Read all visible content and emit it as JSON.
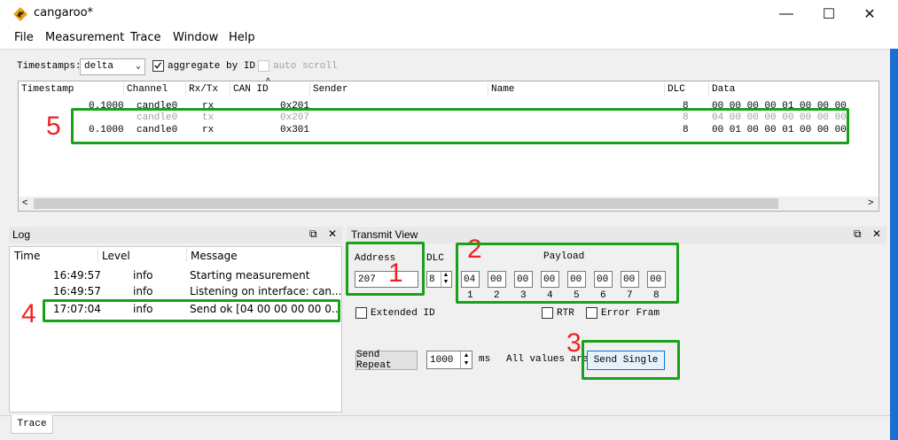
{
  "window": {
    "title": "cangaroo*",
    "minimize": "—",
    "maximize": "☐",
    "close": "✕"
  },
  "menu": [
    "File",
    "Measurement",
    "Trace",
    "Window",
    "Help"
  ],
  "toolbar": {
    "timestamps_label": "Timestamps:",
    "timestamps_value": "delta",
    "aggregate_label": "aggregate by ID",
    "aggregate_checked": true,
    "autoscroll_label": "auto scroll",
    "autoscroll_checked": false
  },
  "trace": {
    "columns": [
      "Timestamp",
      "Channel",
      "Rx/Tx",
      "CAN ID",
      "Sender",
      "Name",
      "DLC",
      "Data"
    ],
    "rows": [
      {
        "timestamp": "0.1000",
        "channel": "candle0",
        "rxtx": "rx",
        "canid": "0x201",
        "dlc": "8",
        "data": "00 00 00 00 01 00 00 00"
      },
      {
        "timestamp": "",
        "channel": "candle0",
        "rxtx": "tx",
        "canid": "0x207",
        "dlc": "8",
        "data": "04 00 00 00 00 00 00 00"
      },
      {
        "timestamp": "0.1000",
        "channel": "candle0",
        "rxtx": "rx",
        "canid": "0x301",
        "dlc": "8",
        "data": "00 01 00 00 01 00 00 00"
      }
    ],
    "scroll_left": "<",
    "scroll_right": ">"
  },
  "log": {
    "title": "Log",
    "columns": [
      "Time",
      "Level",
      "Message"
    ],
    "rows": [
      {
        "time": "16:49:57",
        "level": "info",
        "message": "Starting measurement"
      },
      {
        "time": "16:49:57",
        "level": "info",
        "message": "Listening on interface: can..."
      },
      {
        "time": "17:07:04",
        "level": "info",
        "message": "Send ok [04 00 00 00 00 0..."
      }
    ]
  },
  "transmit": {
    "title": "Transmit View",
    "address_label": "Address",
    "address_value": "207",
    "dlc_label": "DLC",
    "dlc_value": "8",
    "payload_label": "Payload",
    "payload": [
      "04",
      "00",
      "00",
      "00",
      "00",
      "00",
      "00",
      "00"
    ],
    "payload_indices": [
      "1",
      "2",
      "3",
      "4",
      "5",
      "6",
      "7",
      "8"
    ],
    "extended_id_label": "Extended ID",
    "rtr_label": "RTR",
    "error_frame_label": "Error Fram",
    "send_repeat_label": "Send Repeat",
    "repeat_value": "1000",
    "ms_label": "ms",
    "all_values_label": "All values are",
    "send_single_label": "Send Single"
  },
  "annotations": [
    "1",
    "2",
    "3",
    "4",
    "5"
  ],
  "tabs": [
    "Trace"
  ],
  "dock_float_icon": "⧉",
  "dock_close_icon": "✕",
  "colors": {
    "highlight": "#1aa01a",
    "annotation": "#ee2222",
    "accent": "#1a6fd0"
  }
}
